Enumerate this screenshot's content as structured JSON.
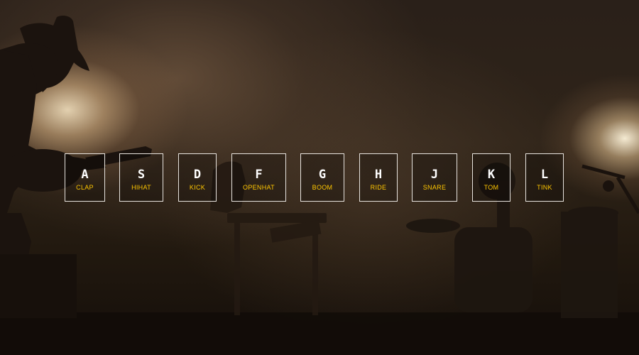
{
  "app": {
    "background": "dark concert stage photo with guitarist silhouette and stage lights"
  },
  "colors": {
    "key_border": "#e8e4df",
    "letter": "#ffffff",
    "sound_label": "#ffc600"
  },
  "keys": [
    {
      "letter": "A",
      "sound": "CLAP"
    },
    {
      "letter": "S",
      "sound": "HIHAT"
    },
    {
      "letter": "D",
      "sound": "KICK"
    },
    {
      "letter": "F",
      "sound": "OPENHAT"
    },
    {
      "letter": "G",
      "sound": "BOOM"
    },
    {
      "letter": "H",
      "sound": "RIDE"
    },
    {
      "letter": "J",
      "sound": "SNARE"
    },
    {
      "letter": "K",
      "sound": "TOM"
    },
    {
      "letter": "L",
      "sound": "TINK"
    }
  ]
}
